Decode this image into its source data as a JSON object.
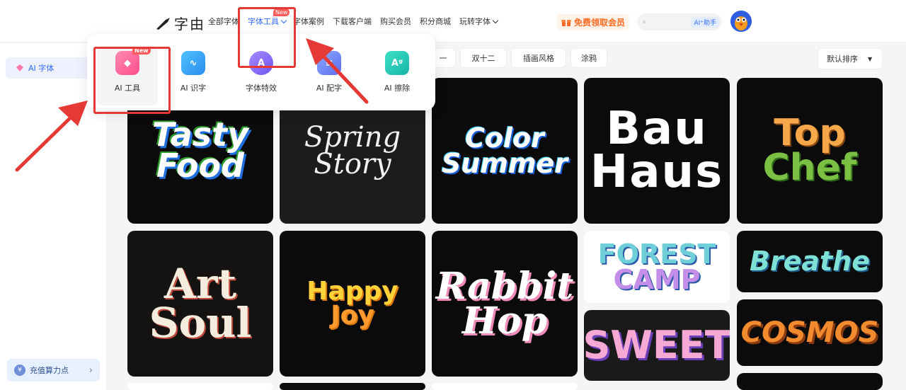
{
  "header": {
    "logo_text": "字由",
    "nav": [
      {
        "label": "全部字体"
      },
      {
        "label": "字体工具",
        "badge": "New"
      },
      {
        "label": "字体案例"
      },
      {
        "label": "下载客户端"
      },
      {
        "label": "购买会员"
      },
      {
        "label": "积分商城"
      },
      {
        "label": "玩转字体"
      }
    ],
    "vip_label": "免费领取会员",
    "search_placeholder": "",
    "ai_help_label": "AI⁺助手"
  },
  "sidebar": {
    "items": [
      {
        "label": "AI 字体"
      }
    ],
    "recharge_label": "充值算力点",
    "recharge_coin": "¥"
  },
  "filters": [
    {
      "label": "一"
    },
    {
      "label": "双十二"
    },
    {
      "label": "插画风格"
    },
    {
      "label": "涂鸦"
    }
  ],
  "sort_label": "默认排序",
  "dropdown": {
    "tools": [
      {
        "label": "AI 工具",
        "badge": "New",
        "glyph": "◆",
        "icon": "diamond-icon"
      },
      {
        "label": "AI 识字",
        "glyph": "∿",
        "icon": "waveform-icon"
      },
      {
        "label": "字体特效",
        "glyph": "A",
        "icon": "sparkle-a-icon"
      },
      {
        "label": "AI 配字",
        "glyph": "≡",
        "icon": "text-lines-icon"
      },
      {
        "label": "AI 擦除",
        "glyph": "Aᵍ",
        "icon": "eraser-icon"
      }
    ]
  },
  "cards": [
    {
      "lines": [
        "Tasty",
        "Food"
      ]
    },
    {
      "lines": [
        "Spring",
        "Story"
      ]
    },
    {
      "lines": [
        "Color",
        "Summer"
      ]
    },
    {
      "lines": [
        "Bau",
        "Haus"
      ]
    },
    {
      "lines": [
        "Top",
        "Chef"
      ]
    },
    {
      "lines": [
        "Art",
        "Soul"
      ]
    },
    {
      "lines": [
        "Happy",
        "Joy"
      ]
    },
    {
      "lines": [
        "Rabbit",
        "Hop"
      ]
    },
    {
      "lines": [
        "FOREST",
        "CAMP"
      ]
    },
    {
      "lines": [
        "Breathe"
      ]
    },
    {
      "lines": [
        "SWEET"
      ]
    },
    {
      "lines": [
        "COSMOS"
      ]
    }
  ],
  "colors": {
    "accent": "#2f6bff",
    "annotation": "#e53935",
    "vip": "#ff6a1f"
  }
}
